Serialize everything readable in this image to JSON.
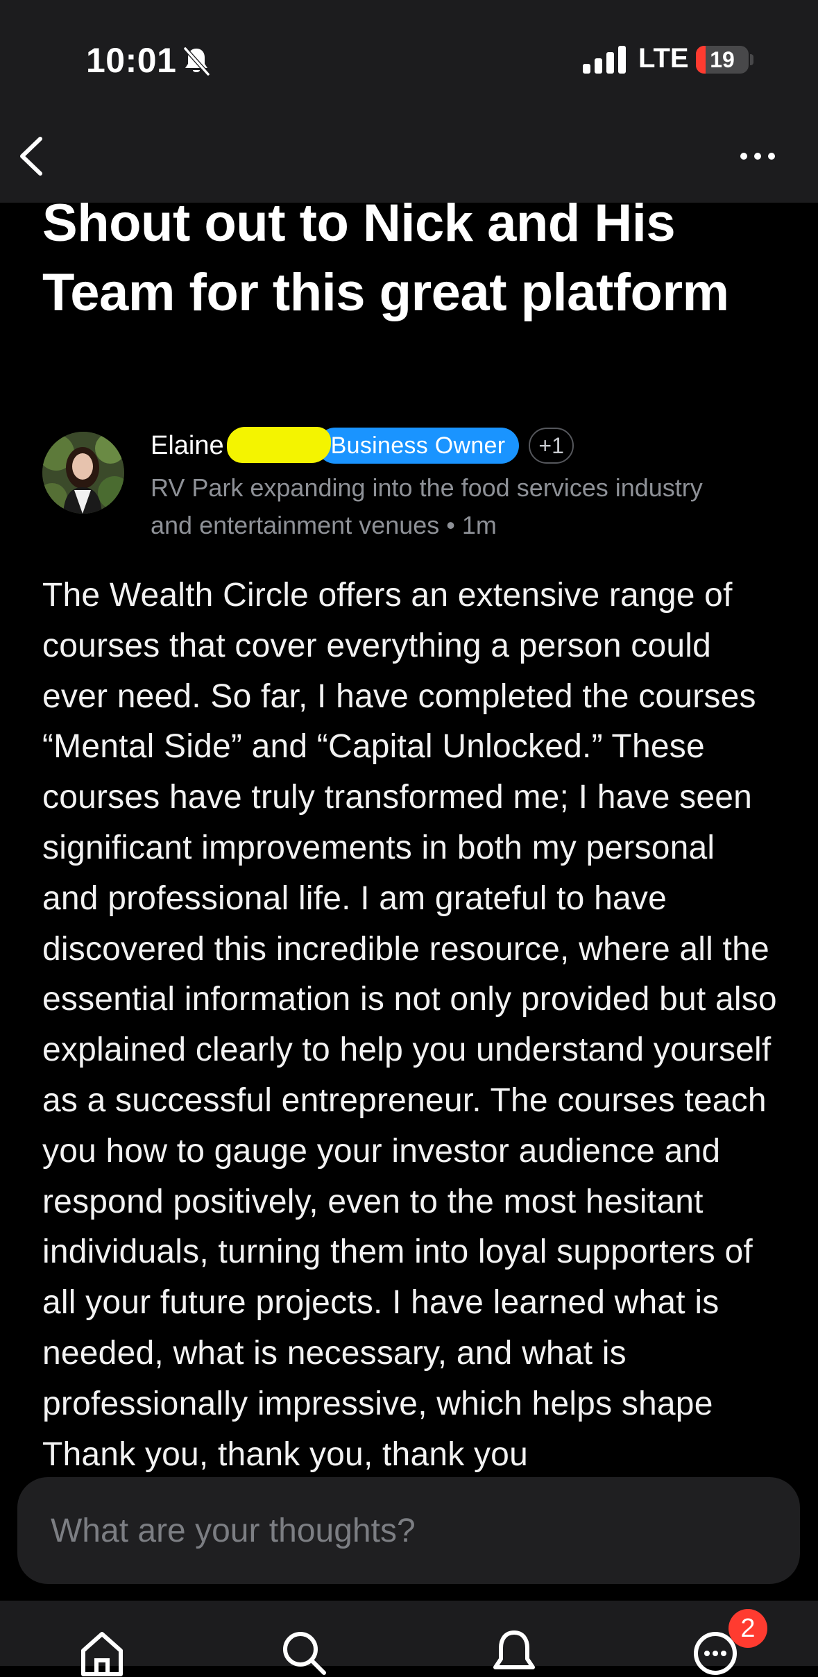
{
  "status_bar": {
    "time": "10:01",
    "network": "LTE",
    "battery_level": "19",
    "battery_fraction": 0.19
  },
  "header": {
    "back_icon": "chevron-left-icon",
    "more_icon": "ellipsis-icon"
  },
  "post": {
    "title": "Shout out to Nick and His Team for this great platform",
    "author": {
      "name": "Elaine",
      "role_badge": "Business Owner",
      "extra_badges": "+1",
      "headline": "RV Park expanding into the food services industry and entertainment venues",
      "separator": " • ",
      "time_ago": "1m",
      "badge_color": "#1a94ff"
    },
    "body": [
      "The Wealth Circle offers an extensive range of courses that cover everything a person could ever need. So far, I have completed the courses “Mental Side” and “Capital Unlocked.” These courses have truly transformed me; I have seen significant improvements in both my personal and professional life. I am grateful to have discovered this incredible resource, where all the essential information is not only provided but also explained clearly to help you understand yourself as a successful entrepreneur. The courses teach you how to gauge your investor audience and respond positively, even to the most hesitant individuals, turning them into loyal supporters of all your future projects. I have learned what is needed, what is necessary, and what is professionally impressive, which helps shape",
      "Thank you, thank you, thank you"
    ]
  },
  "comment_box": {
    "placeholder": "What are your thoughts?"
  },
  "tab_bar": {
    "items": [
      {
        "name": "home",
        "icon": "home-icon"
      },
      {
        "name": "search",
        "icon": "search-icon"
      },
      {
        "name": "notifications",
        "icon": "bell-icon"
      },
      {
        "name": "messages",
        "icon": "chat-bubble-icon"
      }
    ],
    "messages_badge": "2",
    "badge_color": "#ff3b30"
  }
}
